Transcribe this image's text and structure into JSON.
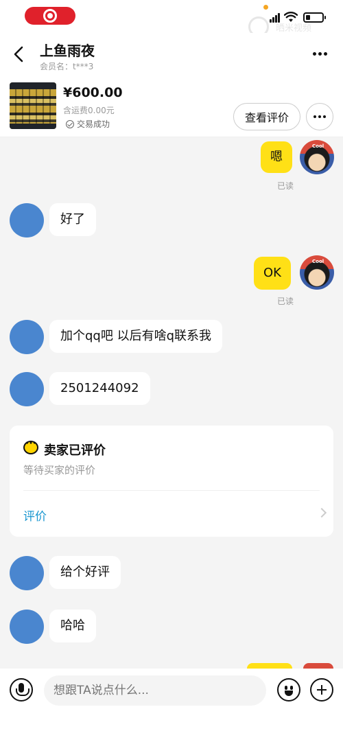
{
  "status_bar": {
    "watermark_text": "晒米视频",
    "icons": [
      "record-icon",
      "signal-icon",
      "wifi-icon",
      "battery-icon"
    ]
  },
  "header": {
    "title": "上鱼雨夜",
    "member_label": "会员名：t***3"
  },
  "product": {
    "price": "¥600.00",
    "shipping": "含运费0.00元",
    "status": "交易成功",
    "review_button": "查看评价"
  },
  "messages": [
    {
      "from": "me",
      "text": "嗯",
      "read": "已读"
    },
    {
      "from": "other",
      "text": "好了"
    },
    {
      "from": "me",
      "text": "OK",
      "read": "已读"
    },
    {
      "from": "other",
      "text": "加个qq吧 以后有啥q联系我"
    },
    {
      "from": "other",
      "text": "2501244092"
    },
    {
      "from": "other",
      "text": "给个好评"
    },
    {
      "from": "other",
      "text": "哈哈"
    }
  ],
  "evaluation_card": {
    "title": "卖家已评价",
    "subtitle": "等待买家的评价",
    "link": "评价"
  },
  "input": {
    "placeholder": "想跟TA说点什么..."
  },
  "avatar_badge": "Cool",
  "colors": {
    "bubble_out": "#ffe016",
    "avatar_other": "#4a86cf",
    "link": "#1a97d0",
    "record_pill": "#e0212b"
  }
}
